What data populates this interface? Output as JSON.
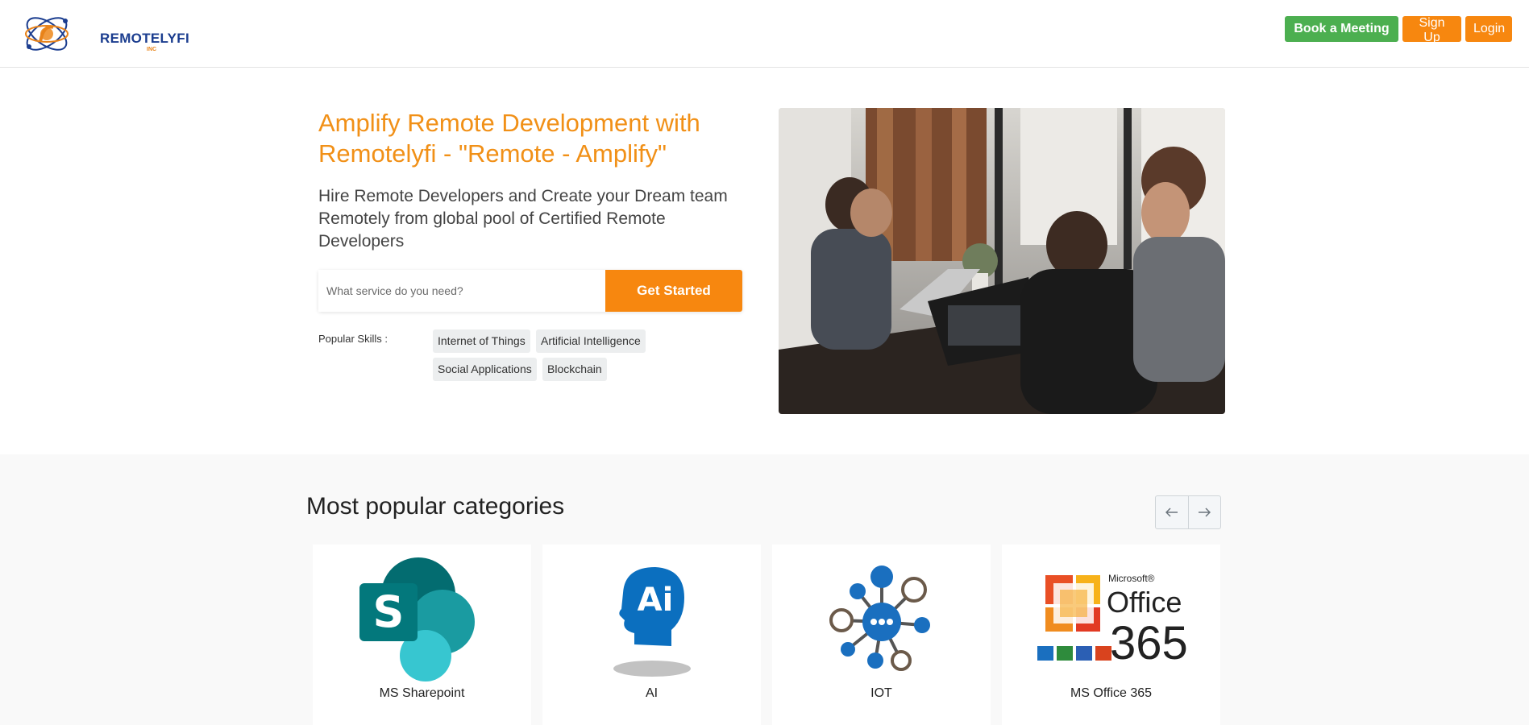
{
  "brand": {
    "name": "REMOTELYFI",
    "sub": "INC"
  },
  "header": {
    "book_meeting": "Book a Meeting",
    "sign_up": "Sign Up",
    "login": "Login"
  },
  "hero": {
    "title": "Amplify Remote Development with Remotelyfi - \"Remote - Amplify\"",
    "subtitle": "Hire Remote Developers and Create your Dream team Remotely from global pool of Certified Remote Developers",
    "search_placeholder": "What service do you need?",
    "search_value": "",
    "get_started": "Get Started",
    "popular_label": "Popular Skills :",
    "skills": [
      "Internet of Things",
      "Artificial Intelligence",
      "Social Applications",
      "Blockchain"
    ]
  },
  "categories": {
    "title": "Most popular categories",
    "items": [
      {
        "label": "MS Sharepoint",
        "icon": "sharepoint-icon"
      },
      {
        "label": "AI",
        "icon": "ai-head-icon"
      },
      {
        "label": "IOT",
        "icon": "iot-network-icon"
      },
      {
        "label": "MS Office 365",
        "icon": "office365-logo"
      }
    ],
    "office_brand": "Microsoft®",
    "office_word": "Office",
    "office_num": "365"
  },
  "colors": {
    "accent": "#f7870f",
    "green": "#4caf50",
    "title": "#f19017"
  }
}
